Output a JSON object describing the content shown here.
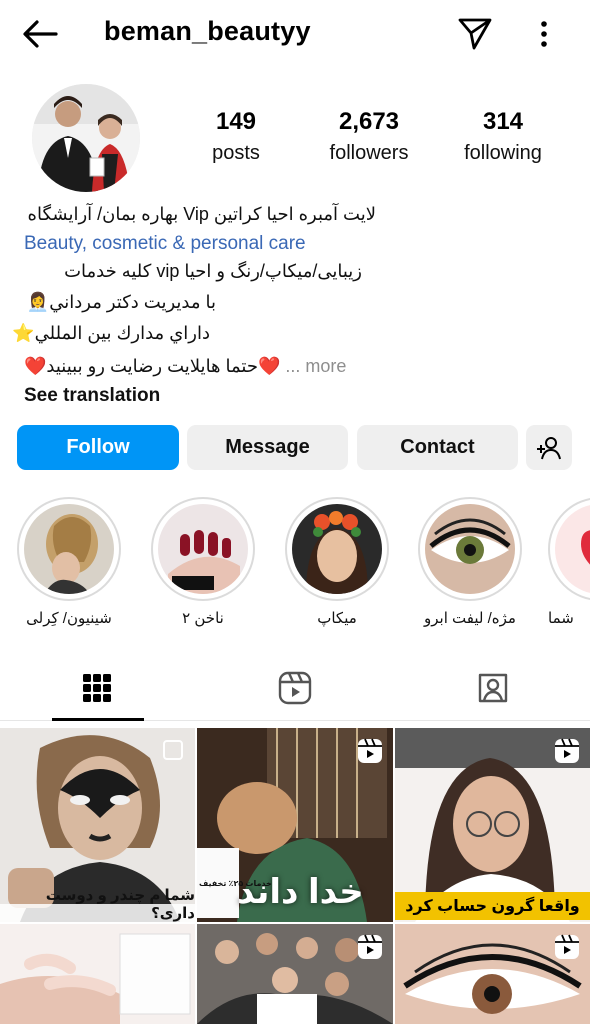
{
  "header": {
    "username": "beman_beautyy",
    "back_icon": "arrow-left-icon",
    "send_icon": "paper-plane-icon",
    "more_icon": "vertical-dots-icon"
  },
  "profile": {
    "stats": [
      {
        "value": "149",
        "label": "posts"
      },
      {
        "value": "2,673",
        "label": "followers"
      },
      {
        "value": "314",
        "label": "following"
      }
    ],
    "bio": {
      "line1": "لایت آمبره احیا کراتین  Vip بهاره بمان/ آرایشگاه",
      "category": "Beauty, cosmetic & personal care",
      "line2": "زیبایی/میکاپ/رنگ و احیا vip کلیه خدمات",
      "line3": "با مدیریت دکتر مرداني",
      "line3_emoji": "👩‍💼",
      "line4": "داراي مدارك بين المللي",
      "line4_emoji": "⭐",
      "line5": "❤️حتما هایلایت رضایت رو ببینید❤️",
      "more": "... more",
      "see_translation": "See translation"
    }
  },
  "actions": {
    "follow": "Follow",
    "message": "Message",
    "contact": "Contact",
    "add_user_icon": "add-person-icon"
  },
  "highlights": [
    {
      "label": "شینیون/ کِرلی"
    },
    {
      "label": "ناخن ۲"
    },
    {
      "label": "میکاپ"
    },
    {
      "label": "مژه/ لیفت ابرو"
    },
    {
      "label": "شما"
    }
  ],
  "tabs": [
    {
      "icon": "grid-icon",
      "active": true
    },
    {
      "icon": "reels-icon",
      "active": false
    },
    {
      "icon": "tagged-icon",
      "active": false
    }
  ],
  "posts": {
    "post1_text": "شما م چندر و دوست داری؟",
    "post2_text": "خدا داند",
    "post3_banner": "واقعا گرون حساب کرد",
    "post2_small": "خدمات ۲۵٪ تخفیف"
  },
  "colors": {
    "primary": "#0095f6",
    "link": "#3a68b5",
    "button_grey": "#efefef"
  }
}
